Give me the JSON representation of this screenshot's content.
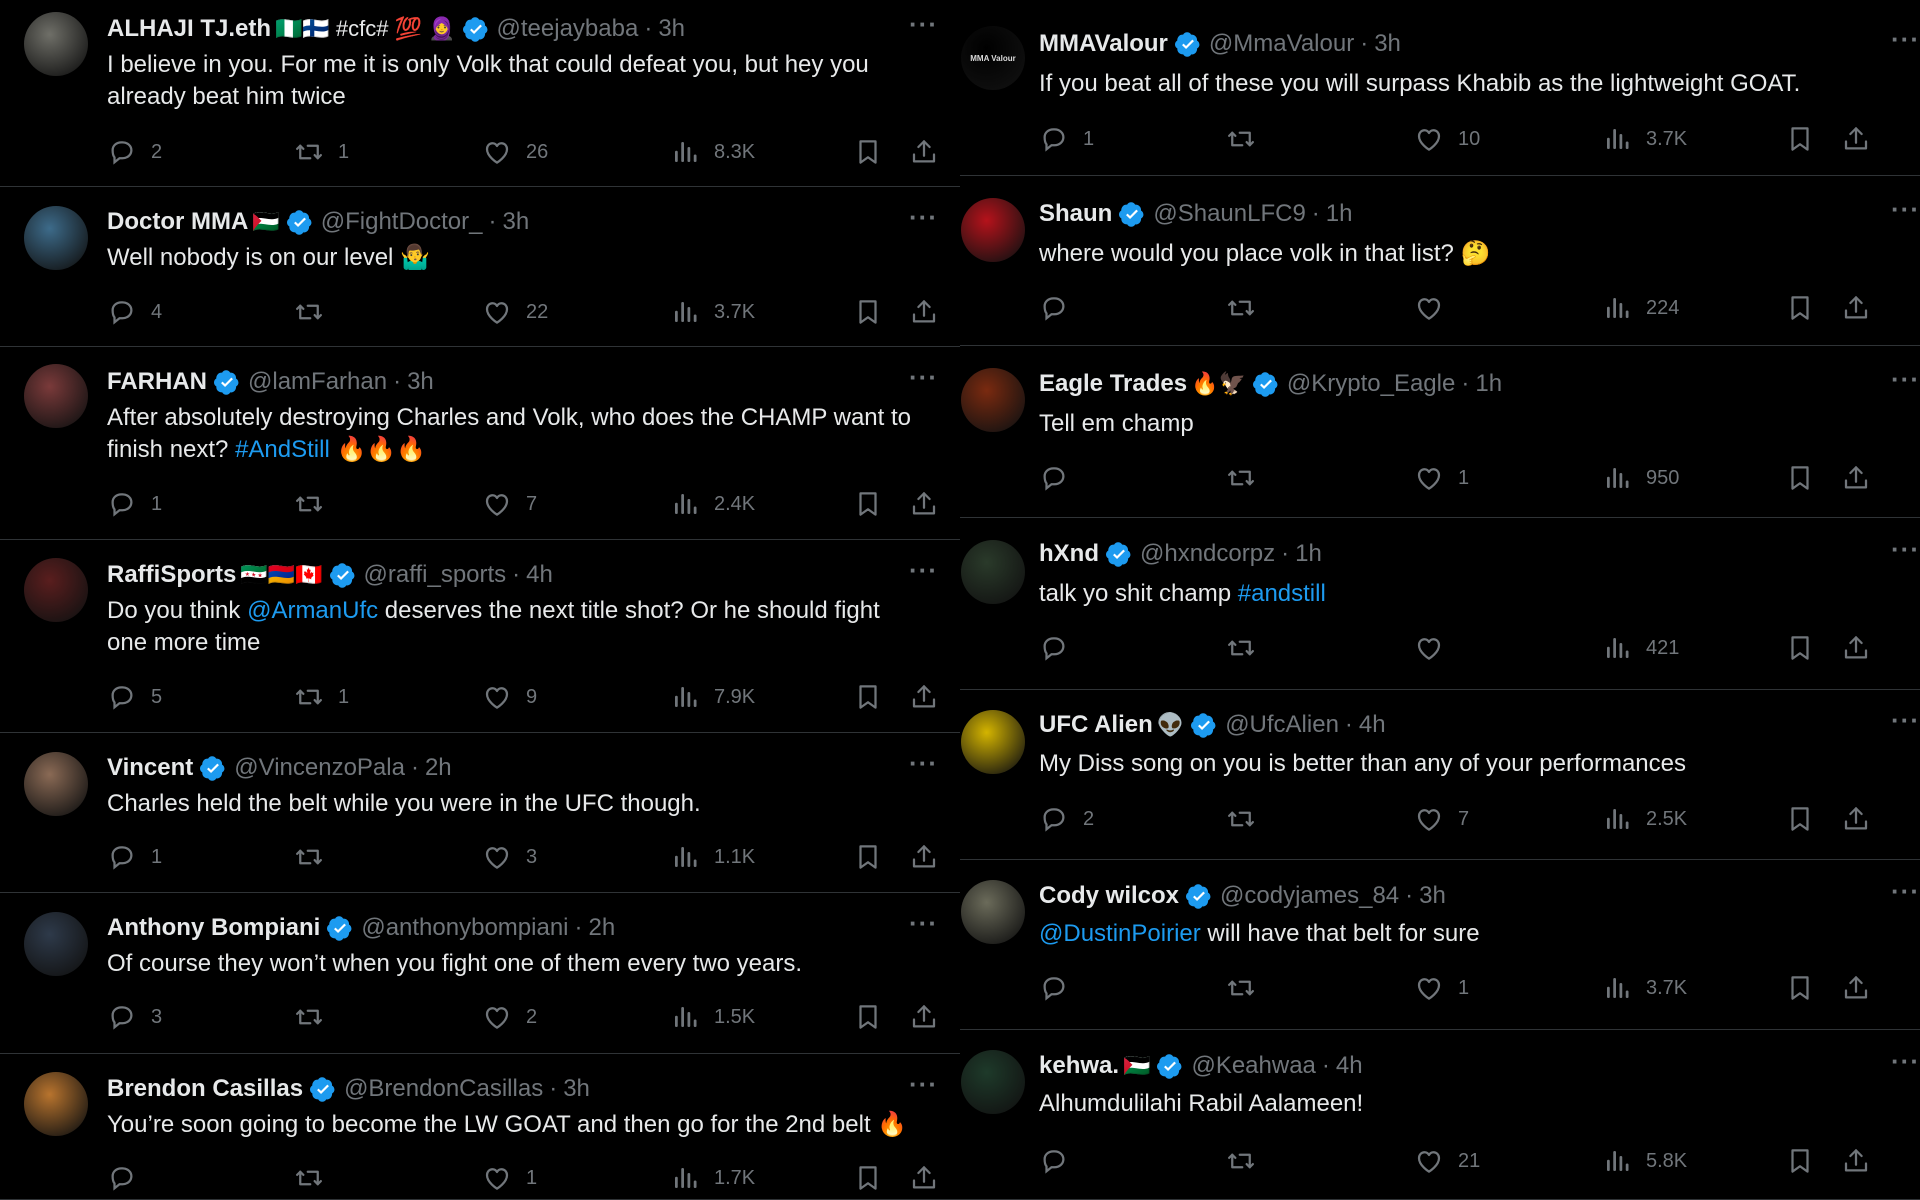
{
  "tweets_left": [
    {
      "name": "ALHAJI TJ.eth",
      "name_emojis": "🇳🇬🇫🇮 #cfc# 💯 🧕",
      "verified": true,
      "handle": "@teejaybaba",
      "time": "3h",
      "text_parts": [
        {
          "t": "I believe in you. For me it is only Volk that could defeat you, but hey you already beat him twice"
        }
      ],
      "replies": "2",
      "retweets": "1",
      "likes": "26",
      "views": "8.3K",
      "avatar_color": "#6f6f68"
    },
    {
      "name": "Doctor MMA",
      "name_emojis": "🇵🇸",
      "verified": true,
      "handle": "@FightDoctor_",
      "time": "3h",
      "text_parts": [
        {
          "t": "Well nobody is on our level 🤷‍♂️"
        }
      ],
      "replies": "4",
      "retweets": "",
      "likes": "22",
      "views": "3.7K",
      "avatar_color": "#3d6b8a"
    },
    {
      "name": "FARHAN",
      "name_emojis": "",
      "verified": true,
      "handle": "@lamFarhan",
      "time": "3h",
      "text_parts": [
        {
          "t": "After absolutely destroying Charles and Volk, who does the CHAMP want to finish next? "
        },
        {
          "t": "#AndStill",
          "link": true
        },
        {
          "t": " 🔥🔥🔥"
        }
      ],
      "replies": "1",
      "retweets": "",
      "likes": "7",
      "views": "2.4K",
      "avatar_color": "#7a3a3a"
    },
    {
      "name": "RaffiSports",
      "name_emojis": "🇸🇾🇦🇲🇨🇦",
      "verified": true,
      "handle": "@raffi_sports",
      "time": "4h",
      "text_parts": [
        {
          "t": "Do you think "
        },
        {
          "t": "@ArmanUfc",
          "link": true
        },
        {
          "t": " deserves the next title shot? Or he should fight one more time"
        }
      ],
      "replies": "5",
      "retweets": "1",
      "likes": "9",
      "views": "7.9K",
      "avatar_color": "#5a1e1e"
    },
    {
      "name": "Vincent",
      "name_emojis": "",
      "verified": true,
      "handle": "@VincenzoPala",
      "time": "2h",
      "text_parts": [
        {
          "t": "Charles held the belt while you were in the UFC though."
        }
      ],
      "replies": "1",
      "retweets": "",
      "likes": "3",
      "views": "1.1K",
      "avatar_color": "#8a6a55"
    },
    {
      "name": "Anthony Bompiani",
      "name_emojis": "",
      "verified": true,
      "handle": "@anthonybompiani",
      "time": "2h",
      "text_parts": [
        {
          "t": "Of course they won’t when you fight one of them every two years."
        }
      ],
      "replies": "3",
      "retweets": "",
      "likes": "2",
      "views": "1.5K",
      "avatar_color": "#2e3a4a"
    },
    {
      "name": "Brendon Casillas",
      "name_emojis": "",
      "verified": true,
      "handle": "@BrendonCasillas",
      "time": "3h",
      "text_parts": [
        {
          "t": "You’re soon going to become the LW GOAT and then go for the 2nd belt 🔥"
        }
      ],
      "replies": "",
      "retweets": "",
      "likes": "1",
      "views": "1.7K",
      "avatar_color": "#b8742e"
    }
  ],
  "tweets_right": [
    {
      "name": "MMAValour",
      "name_emojis": "",
      "verified": true,
      "handle": "@MmaValour",
      "time": "3h",
      "text_parts": [
        {
          "t": "If you beat all of these you will surpass Khabib as the lightweight GOAT."
        }
      ],
      "replies": "1",
      "retweets": "",
      "likes": "10",
      "views": "3.7K",
      "avatar_color": "#000000",
      "avatar_label": "MMA Valour"
    },
    {
      "name": "Shaun",
      "name_emojis": "",
      "verified": true,
      "handle": "@ShaunLFC9",
      "time": "1h",
      "text_parts": [
        {
          "t": "where would you place volk in that list? 🤔"
        }
      ],
      "replies": "",
      "retweets": "",
      "likes": "",
      "views": "224",
      "avatar_color": "#b5121b"
    },
    {
      "name": "Eagle Trades",
      "name_emojis": "🔥🦅",
      "verified": true,
      "handle": "@Krypto_Eagle",
      "time": "1h",
      "text_parts": [
        {
          "t": "Tell em champ"
        }
      ],
      "replies": "",
      "retweets": "",
      "likes": "1",
      "views": "950",
      "avatar_color": "#7a2a10"
    },
    {
      "name": "hXnd",
      "name_emojis": "",
      "verified": true,
      "handle": "@hxndcorpz",
      "time": "1h",
      "text_parts": [
        {
          "t": "talk yo shit champ "
        },
        {
          "t": "#andstill",
          "link": true
        }
      ],
      "replies": "",
      "retweets": "",
      "likes": "",
      "views": "421",
      "avatar_color": "#2a3a2a"
    },
    {
      "name": "UFC Alien",
      "name_emojis": "👽",
      "verified": true,
      "handle": "@UfcAlien",
      "time": "4h",
      "text_parts": [
        {
          "t": "My Diss song on you is better than any of your performances"
        }
      ],
      "replies": "2",
      "retweets": "",
      "likes": "7",
      "views": "2.5K",
      "avatar_color": "#d4b400"
    },
    {
      "name": "Cody wilcox",
      "name_emojis": "",
      "verified": true,
      "handle": "@codyjames_84",
      "time": "3h",
      "text_parts": [
        {
          "t": "@DustinPoirier",
          "link": true
        },
        {
          "t": " will have that belt for sure"
        }
      ],
      "replies": "",
      "retweets": "",
      "likes": "1",
      "views": "3.7K",
      "avatar_color": "#6b6b5a"
    },
    {
      "name": "kehwa.",
      "name_emojis": "🇵🇸",
      "verified": true,
      "handle": "@Keahwaa",
      "time": "4h",
      "text_parts": [
        {
          "t": "Alhumdulilahi Rabil Aalameen!"
        }
      ],
      "replies": "",
      "retweets": "",
      "likes": "21",
      "views": "5.8K",
      "avatar_color": "#1e3a2a"
    }
  ],
  "colors": {
    "background": "#000000",
    "text": "#e7e9ea",
    "muted": "#71767b",
    "link": "#1d9bf0",
    "divider": "#2f3336"
  },
  "icons": [
    "reply-icon",
    "retweet-icon",
    "like-icon",
    "views-icon",
    "bookmark-icon",
    "share-icon",
    "more-icon",
    "verified-badge-icon"
  ]
}
